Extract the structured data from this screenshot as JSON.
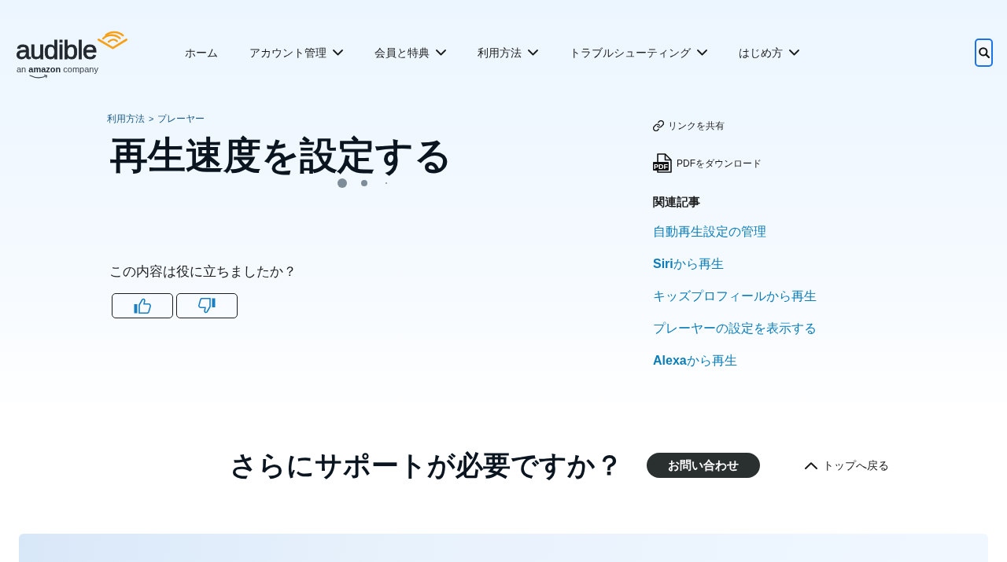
{
  "header": {
    "logo": {
      "wordmark": "audible",
      "tagline": "an **amazon** company"
    },
    "nav": [
      {
        "label": "ホーム",
        "kind": "link"
      },
      {
        "label": "アカウント管理",
        "kind": "menu"
      },
      {
        "label": "会員と特典",
        "kind": "menu"
      },
      {
        "label": "利用方法",
        "kind": "menu"
      },
      {
        "label": "トラブルシューティング",
        "kind": "menu"
      },
      {
        "label": "はじめ方",
        "kind": "menu"
      }
    ],
    "search_button": {
      "focused": true
    }
  },
  "breadcrumb": {
    "items": [
      "利用方法",
      "プレーヤー"
    ],
    "separator": ">"
  },
  "article": {
    "title": "再生速度を設定する",
    "loading": true
  },
  "feedback": {
    "question": "この内容は役に立ちましたか？",
    "buttons": [
      {
        "kind": "thumbs_up"
      },
      {
        "kind": "thumbs_down"
      }
    ]
  },
  "sidebar": {
    "actions": [
      {
        "kind": "share",
        "label": "リンクを共有"
      },
      {
        "kind": "pdf",
        "label": "PDFをダウンロード",
        "icon_text": "PDF"
      }
    ],
    "related": {
      "heading": "関連記事",
      "links": [
        "自動再生設定の管理",
        "**Siri**から再生",
        "キッズプロフィールから再生",
        "プレーヤーの設定を表示する",
        "**Alexa**から再生"
      ]
    }
  },
  "support": {
    "heading": "さらにサポートが必要ですか？",
    "contact_button": "お問い合わせ",
    "back_to_top": "トップへ戻る"
  }
}
